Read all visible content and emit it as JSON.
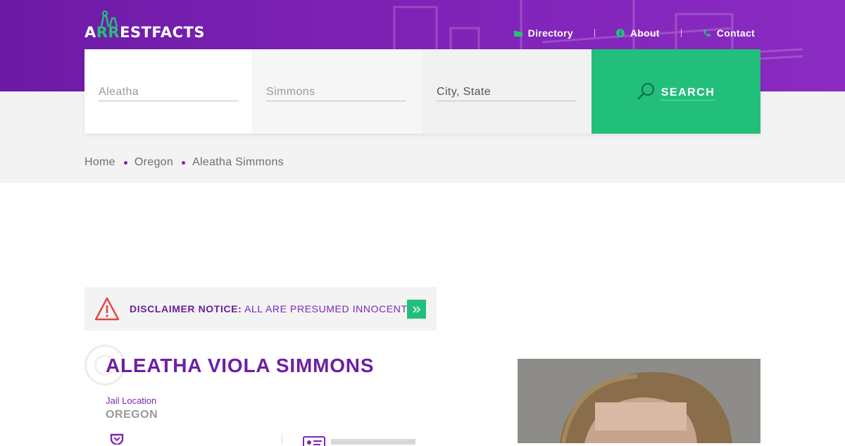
{
  "brand": {
    "logo_prefix": "A",
    "logo_highlight": "RR",
    "logo_suffix": "ESTFACTS"
  },
  "nav": {
    "items": [
      {
        "label": "Directory",
        "icon": "folder-icon"
      },
      {
        "label": "About",
        "icon": "info-icon"
      },
      {
        "label": "Contact",
        "icon": "phone-icon"
      }
    ]
  },
  "search": {
    "first_name_value": "Aleatha",
    "last_name_value": "Simmons",
    "location_placeholder": "City, State",
    "button_label": "SEARCH",
    "button_icon": "search-icon"
  },
  "breadcrumb": [
    "Home",
    "Oregon",
    "Aleatha Simmons"
  ],
  "disclaimer": {
    "icon": "warning-icon",
    "title": "DISCLAIMER NOTICE:",
    "text": "ALL ARE PRESUMED INNOCENT...",
    "expand_icon": "double-chevron-right-icon"
  },
  "person": {
    "name": "ALEATHA VIOLA SIMMONS",
    "jail_location_label": "Jail Location",
    "jail_location_value": "OREGON"
  },
  "colors": {
    "brand_purple": "#7e22b6",
    "accent_green": "#22bf7b",
    "warning_red": "#e2463e"
  }
}
